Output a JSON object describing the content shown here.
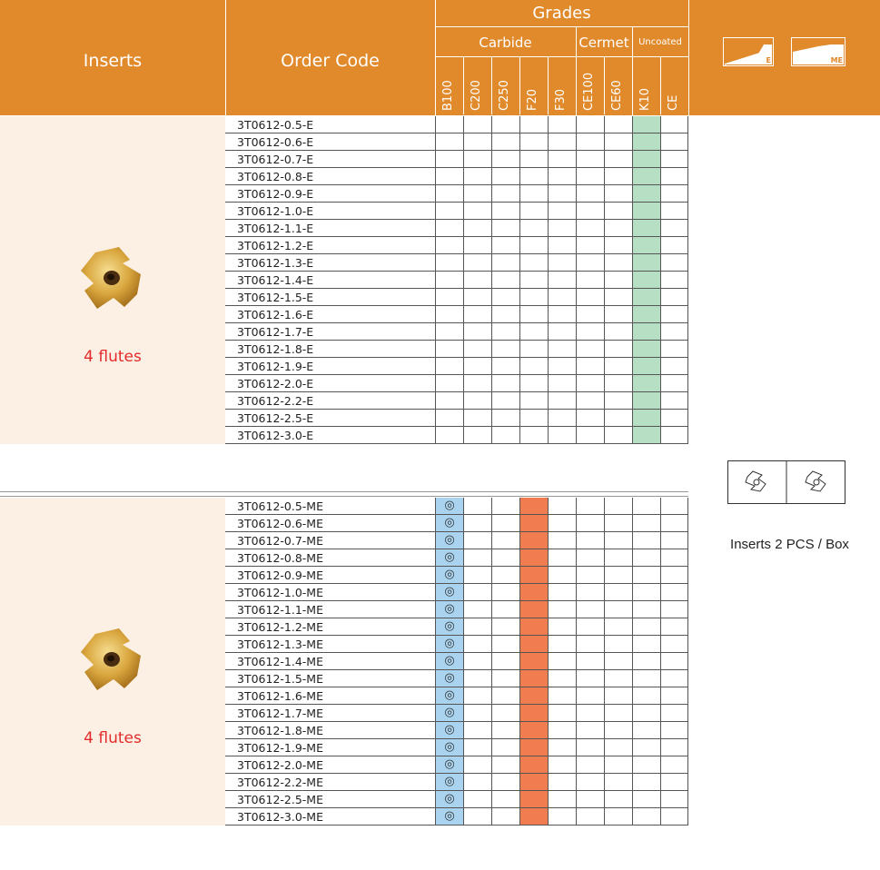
{
  "header": {
    "inserts": "Inserts",
    "order_code": "Order Code",
    "grades": "Grades",
    "carbide": "Carbide",
    "cermet": "Cermet",
    "uncoated": "Uncoated",
    "grade_columns": [
      "B100",
      "C200",
      "C250",
      "F20",
      "F30",
      "CE100",
      "CE60",
      "K10",
      "CE"
    ],
    "icon_e_label": "E",
    "icon_me_label": "ME",
    "header_color": "#e08a2c"
  },
  "sections": [
    {
      "flutes_label": "4 flutes",
      "insert_image_icon": "gold-insert-icon",
      "mark_symbol": "◎",
      "rows": [
        {
          "code": "3T0612-0.5-E"
        },
        {
          "code": "3T0612-0.6-E"
        },
        {
          "code": "3T0612-0.7-E"
        },
        {
          "code": "3T0612-0.8-E"
        },
        {
          "code": "3T0612-0.9-E"
        },
        {
          "code": "3T0612-1.0-E"
        },
        {
          "code": "3T0612-1.1-E"
        },
        {
          "code": "3T0612-1.2-E"
        },
        {
          "code": "3T0612-1.3-E"
        },
        {
          "code": "3T0612-1.4-E"
        },
        {
          "code": "3T0612-1.5-E"
        },
        {
          "code": "3T0612-1.6-E"
        },
        {
          "code": "3T0612-1.7-E"
        },
        {
          "code": "3T0612-1.8-E"
        },
        {
          "code": "3T0612-1.9-E"
        },
        {
          "code": "3T0612-2.0-E"
        },
        {
          "code": "3T0612-2.2-E"
        },
        {
          "code": "3T0612-2.5-E"
        },
        {
          "code": "3T0612-3.0-E"
        }
      ],
      "highlight": {
        "K10": "#b7dfc4"
      },
      "marked_grades": []
    },
    {
      "flutes_label": "4 flutes",
      "insert_image_icon": "gold-insert-icon",
      "mark_symbol": "◎",
      "rows": [
        {
          "code": "3T0612-0.5-ME"
        },
        {
          "code": "3T0612-0.6-ME"
        },
        {
          "code": "3T0612-0.7-ME"
        },
        {
          "code": "3T0612-0.8-ME"
        },
        {
          "code": "3T0612-0.9-ME"
        },
        {
          "code": "3T0612-1.0-ME"
        },
        {
          "code": "3T0612-1.1-ME"
        },
        {
          "code": "3T0612-1.2-ME"
        },
        {
          "code": "3T0612-1.3-ME"
        },
        {
          "code": "3T0612-1.4-ME"
        },
        {
          "code": "3T0612-1.5-ME"
        },
        {
          "code": "3T0612-1.6-ME"
        },
        {
          "code": "3T0612-1.7-ME"
        },
        {
          "code": "3T0612-1.8-ME"
        },
        {
          "code": "3T0612-1.9-ME"
        },
        {
          "code": "3T0612-2.0-ME"
        },
        {
          "code": "3T0612-2.2-ME"
        },
        {
          "code": "3T0612-2.5-ME"
        },
        {
          "code": "3T0612-3.0-ME"
        }
      ],
      "highlight": {
        "B100": "#a9d3ef",
        "F20": "#f07c4f"
      },
      "marked_grades": [
        "B100"
      ]
    }
  ],
  "packaging": {
    "label": "Inserts 2 PCS / Box",
    "icon": "insert-outline-icon"
  }
}
